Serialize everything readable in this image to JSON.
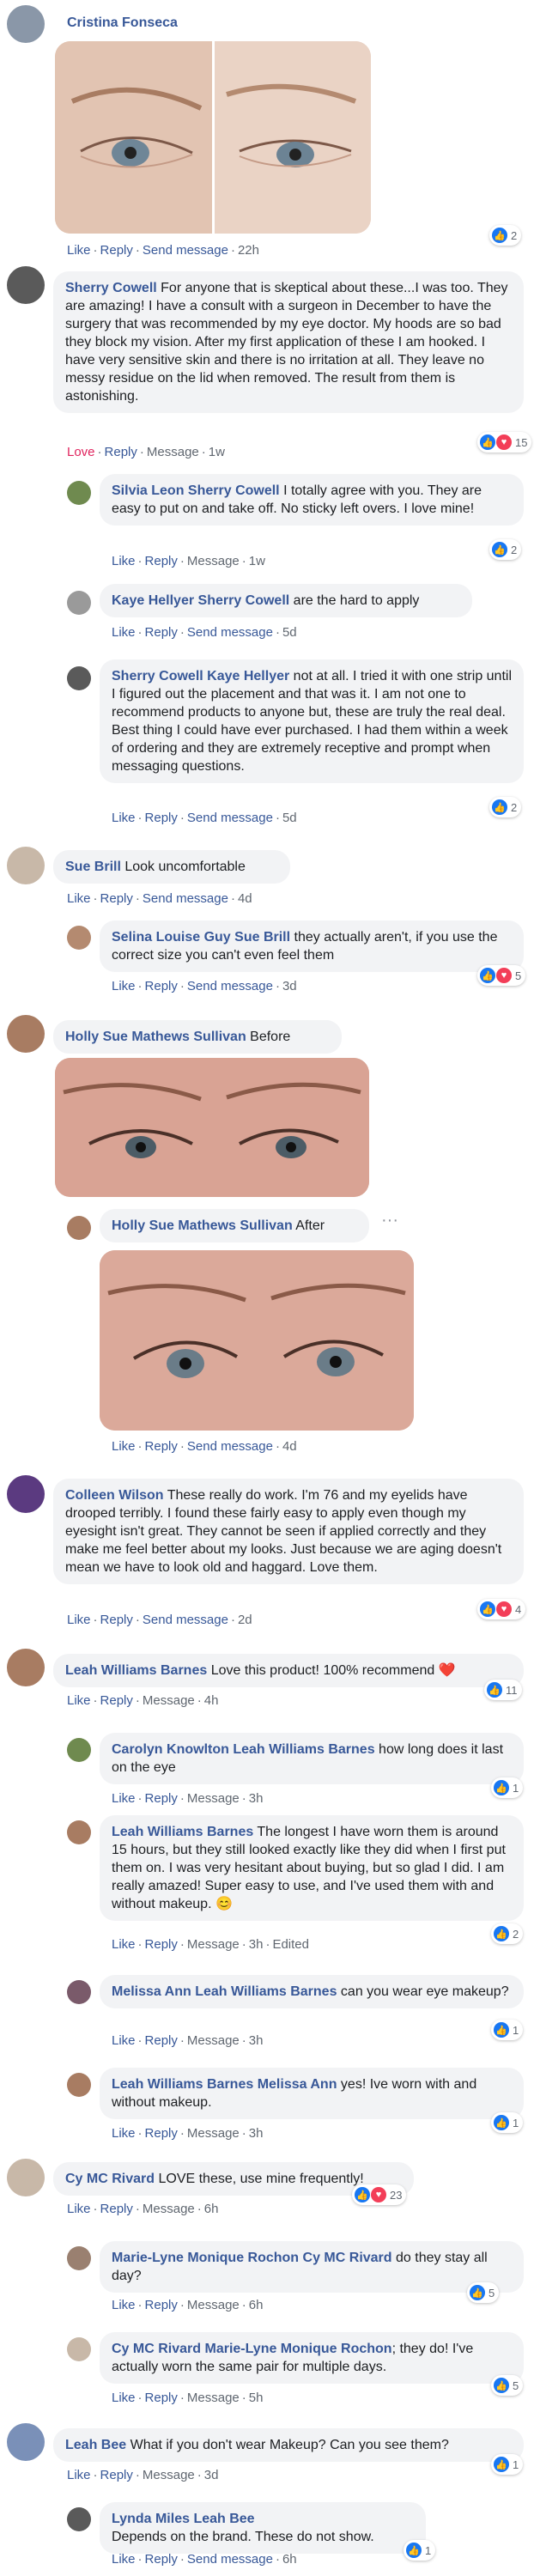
{
  "actions": {
    "like": "Like",
    "reply": "Reply",
    "send_message": "Send message",
    "message": "Message",
    "love": "Love",
    "edited": "Edited"
  },
  "comments": {
    "c1": {
      "name": "Cristina Fonseca",
      "time": "22h",
      "reactions": "2"
    },
    "c2": {
      "name": "Sherry Cowell",
      "text": " For anyone that is skeptical about these...I was too. They are amazing! I have a consult with a surgeon in December to have the surgery that was recommended by my eye doctor. My hoods are so bad they block my vision. After my first application of these I am hooked. I have very sensitive skin and there is no irritation at all. They leave no messy residue on the lid when removed. The result from them is astonishing.",
      "time": "1w",
      "reactions": "15"
    },
    "c2r1": {
      "name": "Silvia Leon",
      "mention": "Sherry Cowell",
      "text": " I totally agree with you. They are easy to put on and take off. No sticky left overs. I love mine!",
      "time": "1w",
      "reactions": "2"
    },
    "c2r2": {
      "name": "Kaye Hellyer",
      "mention": "Sherry Cowell",
      "text": " are the hard to apply",
      "time": "5d"
    },
    "c2r3": {
      "name": "Sherry Cowell",
      "mention": "Kaye Hellyer",
      "text": " not at all. I tried it with one strip until I figured out the placement and that was it. I am not one to recommend products to anyone but, these are truly the real deal. Best thing I could have ever purchased. I had them within a week of ordering and they are extremely receptive and prompt when messaging questions.",
      "time": "5d",
      "reactions": "2"
    },
    "c3": {
      "name": "Sue Brill",
      "text": " Look uncomfortable",
      "time": "4d"
    },
    "c3r1": {
      "name": "Selina Louise Guy",
      "mention": "Sue Brill",
      "text": " they actually aren't, if you use the correct size you can't even feel them",
      "time": "3d",
      "reactions": "5"
    },
    "c4": {
      "name": "Holly Sue Mathews Sullivan",
      "text": " Before"
    },
    "c4r1": {
      "name": "Holly Sue Mathews Sullivan",
      "text": " After",
      "time": "4d"
    },
    "c5": {
      "name": "Colleen Wilson",
      "text": " These really do work. I'm 76 and my eyelids have drooped terribly. I found these fairly easy to apply even though my eyesight isn't great. They cannot be seen if applied correctly and they make me feel better about my looks. Just because we are aging doesn't mean we have to look old and haggard. Love them.",
      "time": "2d",
      "reactions": "4"
    },
    "c6": {
      "name": "Leah Williams Barnes",
      "text": " Love this product! 100% recommend ",
      "emoji": "❤️",
      "time": "4h",
      "reactions": "11"
    },
    "c6r1": {
      "name": "Carolyn Knowlton",
      "mention": "Leah Williams Barnes",
      "text": " how long does it last on the eye",
      "time": "3h",
      "reactions": "1"
    },
    "c6r2": {
      "name": "Leah Williams Barnes",
      "text": " The longest I have worn them is around 15 hours, but they still looked exactly like they did when I first put them on. I was very hesitant about buying, but so glad I did. I am really amazed! Super easy to use, and I've used them with and without makeup. ",
      "emoji": "😊",
      "time": "3h",
      "reactions": "2"
    },
    "c6r3": {
      "name": "Melissa Ann",
      "mention": "Leah Williams Barnes",
      "text": " can you wear eye makeup?",
      "time": "3h",
      "reactions": "1"
    },
    "c6r4": {
      "name": "Leah Williams Barnes",
      "mention": "Melissa Ann",
      "text": " yes! Ive worn with and without makeup.",
      "time": "3h",
      "reactions": "1"
    },
    "c7": {
      "name": "Cy MC Rivard",
      "text": " LOVE these, use mine frequently!",
      "time": "6h",
      "reactions": "23"
    },
    "c7r1": {
      "name": "Marie-Lyne Monique Rochon",
      "mention": "Cy MC Rivard",
      "text": " do they stay all day?",
      "time": "6h",
      "reactions": "5"
    },
    "c7r2": {
      "name": "Cy MC Rivard",
      "mention": "Marie-Lyne Monique Rochon",
      "text": "; they do! I've actually worn the same pair for multiple days.",
      "time": "5h",
      "reactions": "5"
    },
    "c8": {
      "name": "Leah Bee",
      "text": " What if you don't wear Makeup? Can you see them?",
      "time": "3d",
      "reactions": "1"
    },
    "c8r1": {
      "name": "Lynda Miles",
      "mention": "Leah Bee",
      "text": "Depends on the brand. These do not show.",
      "time": "6h",
      "reactions": "1"
    }
  },
  "colors": {
    "link": "#385898",
    "love": "#e0245e",
    "bubble": "#f2f3f5",
    "like_blue": "#1877f2",
    "heart": "#f33e58"
  },
  "icons": {
    "like": "like-icon",
    "heart": "heart-icon",
    "more": "more-options-icon"
  }
}
